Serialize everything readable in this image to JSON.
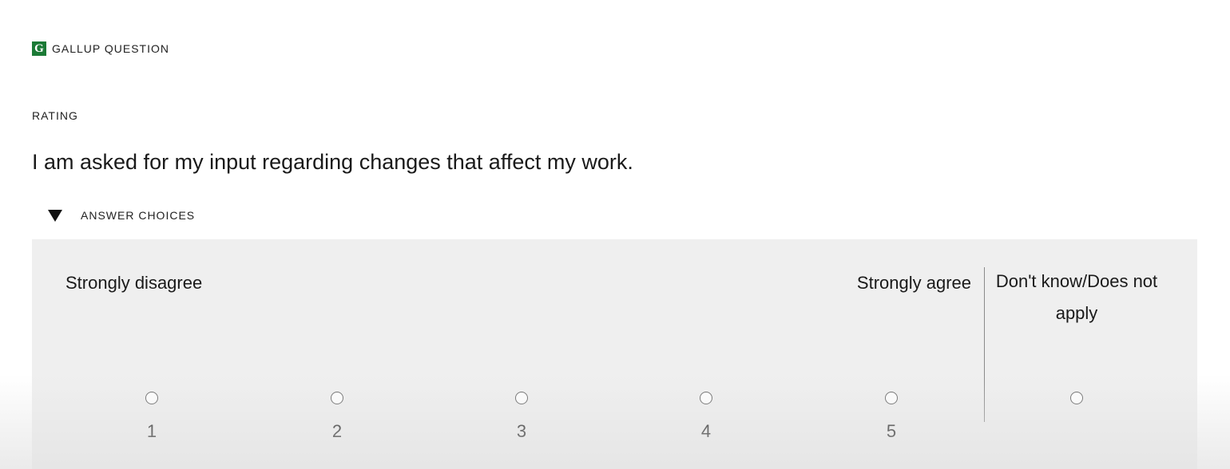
{
  "header": {
    "logo_letter": "G",
    "label": "GALLUP QUESTION",
    "brand_color": "#1b7a36"
  },
  "question": {
    "type_label": "RATING",
    "text": "I am asked for my input regarding changes that affect my work."
  },
  "answer_choices": {
    "toggle_label": "ANSWER CHOICES",
    "toggle_icon": "triangle-down-icon",
    "expanded": true,
    "anchor_low": "Strongly disagree",
    "anchor_high": "Strongly agree",
    "not_applicable_label": "Don't know/Does not apply",
    "options": [
      {
        "label": "1",
        "selected": false
      },
      {
        "label": "2",
        "selected": false
      },
      {
        "label": "3",
        "selected": false
      },
      {
        "label": "4",
        "selected": false
      },
      {
        "label": "5",
        "selected": false
      }
    ],
    "not_applicable_selected": false
  }
}
